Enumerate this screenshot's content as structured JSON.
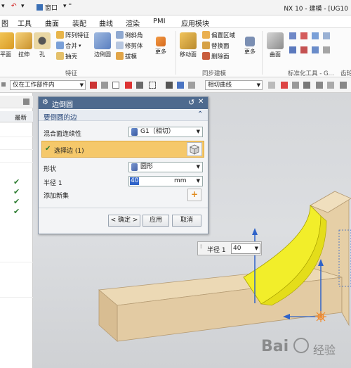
{
  "titlebar": {
    "window_menu": "窗口",
    "title": "NX 10 - 建模 - [UG10"
  },
  "menubar": {
    "items": [
      "图",
      "工具",
      "曲面",
      "装配",
      "曲线",
      "渲染",
      "PMI",
      "应用模块"
    ]
  },
  "ribbon": {
    "big_buttons": [
      {
        "label": "平面",
        "icon": "datum-plane-icon"
      },
      {
        "label": "拉伸",
        "icon": "extrude-icon"
      },
      {
        "label": "孔",
        "icon": "hole-icon"
      },
      {
        "label": "边倒圆",
        "icon": "edge-blend-icon"
      },
      {
        "label": "更多",
        "icon": "more-icon"
      },
      {
        "label": "移动面",
        "icon": "move-face-icon"
      },
      {
        "label": "更多",
        "icon": "more-icon"
      },
      {
        "label": "曲面",
        "icon": "surface-icon"
      }
    ],
    "small_buttons": [
      {
        "label": "阵列特征"
      },
      {
        "label": "合并"
      },
      {
        "label": "抽壳"
      },
      {
        "label": "倒斜角"
      },
      {
        "label": "修剪体"
      },
      {
        "label": "拔模"
      },
      {
        "label": "偏置区域"
      },
      {
        "label": "替换面"
      },
      {
        "label": "删除面"
      }
    ],
    "groups": [
      "特征",
      "同步建模",
      "标准化工具 - G...",
      "齿轮"
    ]
  },
  "selbar": {
    "scope": "仅在工作部件内",
    "curve_rule": "相切曲线"
  },
  "leftpanel": {
    "header_latest": "最新",
    "check_count": 4
  },
  "dialog": {
    "title": "边倒圆",
    "section_title": "要倒圆的边",
    "continuity_label": "混合面连续性",
    "continuity_value": "G1（相切）",
    "select_edge": "选择边 (1)",
    "shape_label": "形状",
    "shape_value": "圆形",
    "radius_label": "半径 1",
    "radius_value": "40",
    "radius_unit": "mm",
    "add_new_set": "添加新集",
    "ok": "< 确定 >",
    "apply": "应用",
    "cancel": "取消"
  },
  "viewport_popup": {
    "label": "半径 1",
    "value": "40"
  },
  "watermark": {
    "brand": "Bai",
    "suffix": "经验"
  },
  "colors": {
    "dialog_title": "#4e6a8e",
    "selected_row": "#f5c86a",
    "part_body": "#e6d3b0",
    "blend_surface": "#f2ee2a",
    "axis_blue": "#2f63c9"
  }
}
